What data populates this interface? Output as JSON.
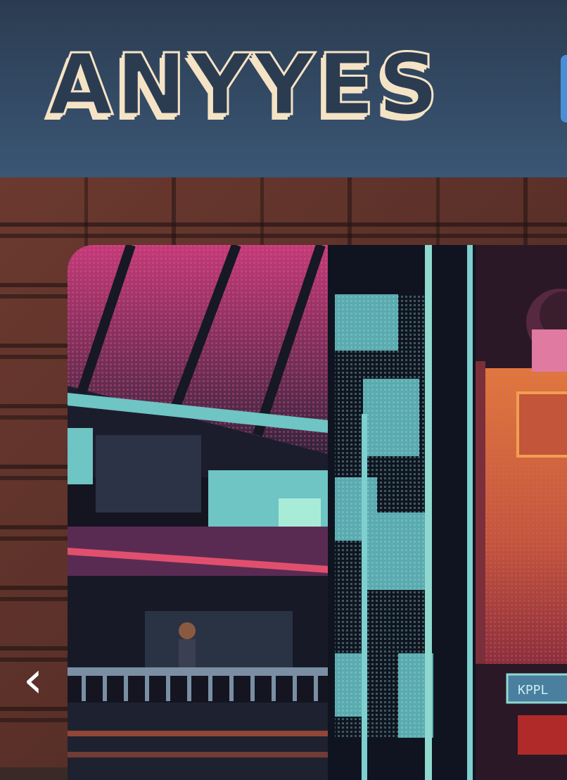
{
  "header": {
    "logo_text": "ANYYES"
  },
  "carousel": {
    "prev_icon": "chevron-left-icon",
    "prev_glyph": "‹",
    "slide_sign_text": "KPPL"
  },
  "colors": {
    "header_top": "#2b3c51",
    "header_bottom": "#3a5675",
    "logo_cream": "#f5e3c5",
    "accent_blue": "#4a8fd6",
    "neon_pink": "#c43a78",
    "neon_teal": "#6fc4c4",
    "orange_billboard": "#e0793a"
  }
}
